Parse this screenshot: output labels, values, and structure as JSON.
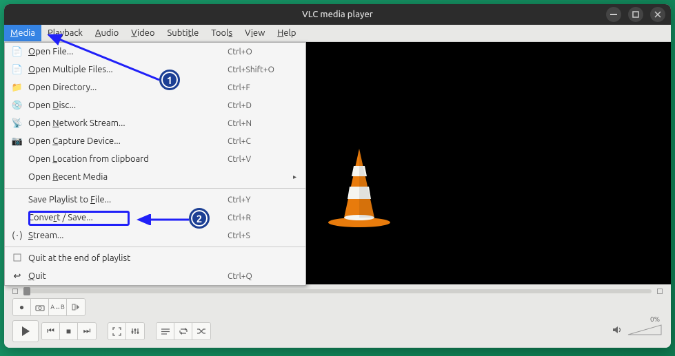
{
  "title": "VLC media player",
  "menubar": {
    "media": "Media",
    "playback": "Playback",
    "audio": "Audio",
    "video": "Video",
    "subtitle": "Subtitle",
    "tools": "Tools",
    "view": "View",
    "help": "Help"
  },
  "dropdown": {
    "open_file": {
      "label": "Open File...",
      "shortcut": "Ctrl+O"
    },
    "open_multi": {
      "label": "Open Multiple Files...",
      "shortcut": "Ctrl+Shift+O"
    },
    "open_dir": {
      "label": "Open Directory...",
      "shortcut": "Ctrl+F"
    },
    "open_disc": {
      "label": "Open Disc...",
      "shortcut": "Ctrl+D"
    },
    "open_net": {
      "label": "Open Network Stream...",
      "shortcut": "Ctrl+N"
    },
    "open_cap": {
      "label": "Open Capture Device...",
      "shortcut": "Ctrl+C"
    },
    "open_loc": {
      "label": "Open Location from clipboard",
      "shortcut": "Ctrl+V"
    },
    "open_recent": {
      "label": "Open Recent Media",
      "shortcut": ""
    },
    "save_pl": {
      "label": "Save Playlist to File...",
      "shortcut": "Ctrl+Y"
    },
    "convert": {
      "label": "Convert / Save...",
      "shortcut": "Ctrl+R"
    },
    "stream": {
      "label": "Stream...",
      "shortcut": "Ctrl+S"
    },
    "quit_end": {
      "label": "Quit at the end of playlist",
      "shortcut": ""
    },
    "quit": {
      "label": "Quit",
      "shortcut": "Ctrl+Q"
    }
  },
  "volume": {
    "pct": "0%"
  },
  "annotations": {
    "step1": "1",
    "step2": "2"
  }
}
